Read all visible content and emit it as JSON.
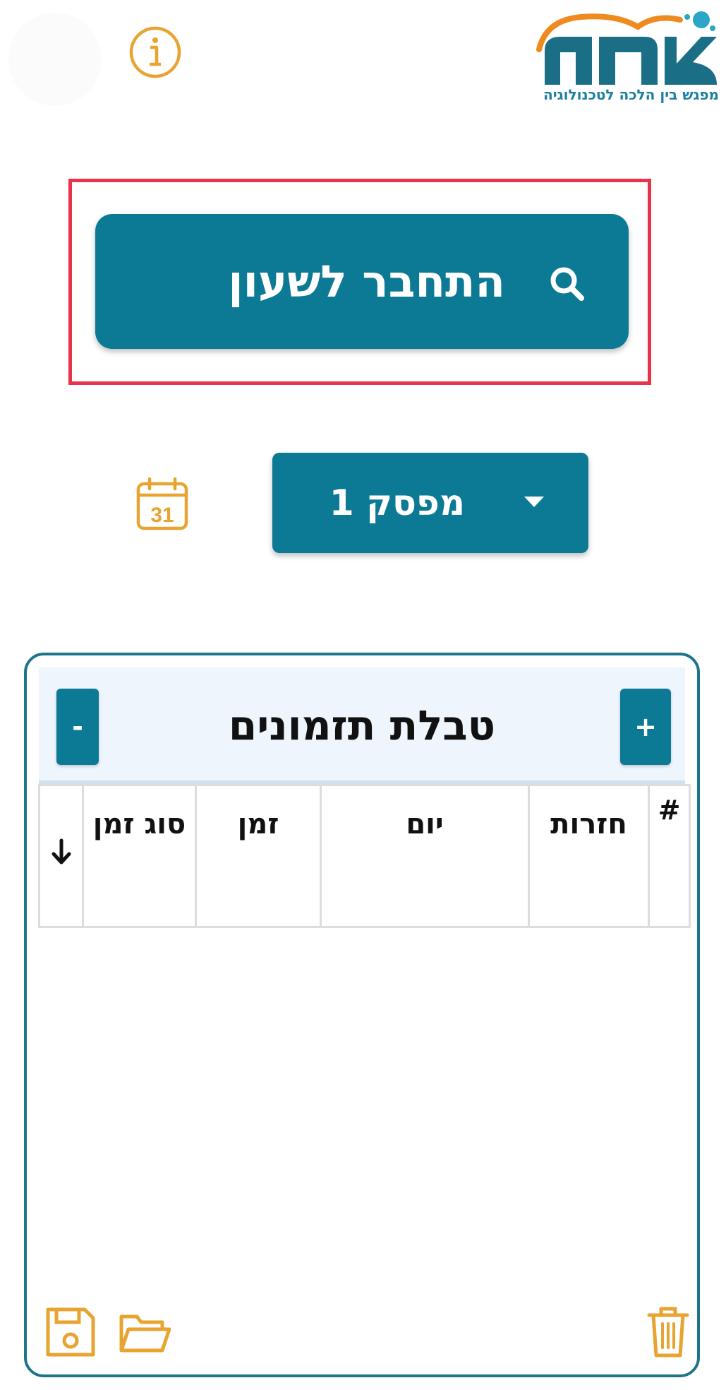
{
  "brand": {
    "logo_text": "צמת",
    "tagline": "מפגש בין הלכה לטכנולוגיה",
    "logo_icon": "tzomet-logo",
    "colors": {
      "primary": "#0c7a95",
      "accent": "#e8a430",
      "logo_orange": "#ef8a1f",
      "highlight": "#e8344a"
    }
  },
  "header": {
    "info_icon": "info-icon",
    "avatar_icon": "avatar"
  },
  "connect": {
    "label": "התחבר לשעון",
    "icon": "search-icon"
  },
  "schedule": {
    "calendar_icon": "calendar-icon",
    "calendar_day": "31",
    "selected_switch": "מפסק 1",
    "dropdown_icon": "caret-down-icon"
  },
  "table": {
    "title": "טבלת תזמונים",
    "add_label": "+",
    "remove_label": "-",
    "columns": [
      "#",
      "חזרות",
      "יום",
      "זמן",
      "סוג זמן",
      "↓"
    ],
    "rows": []
  },
  "footer": {
    "save_icon": "save-icon",
    "folder_icon": "folder-icon",
    "trash_icon": "trash-icon"
  }
}
